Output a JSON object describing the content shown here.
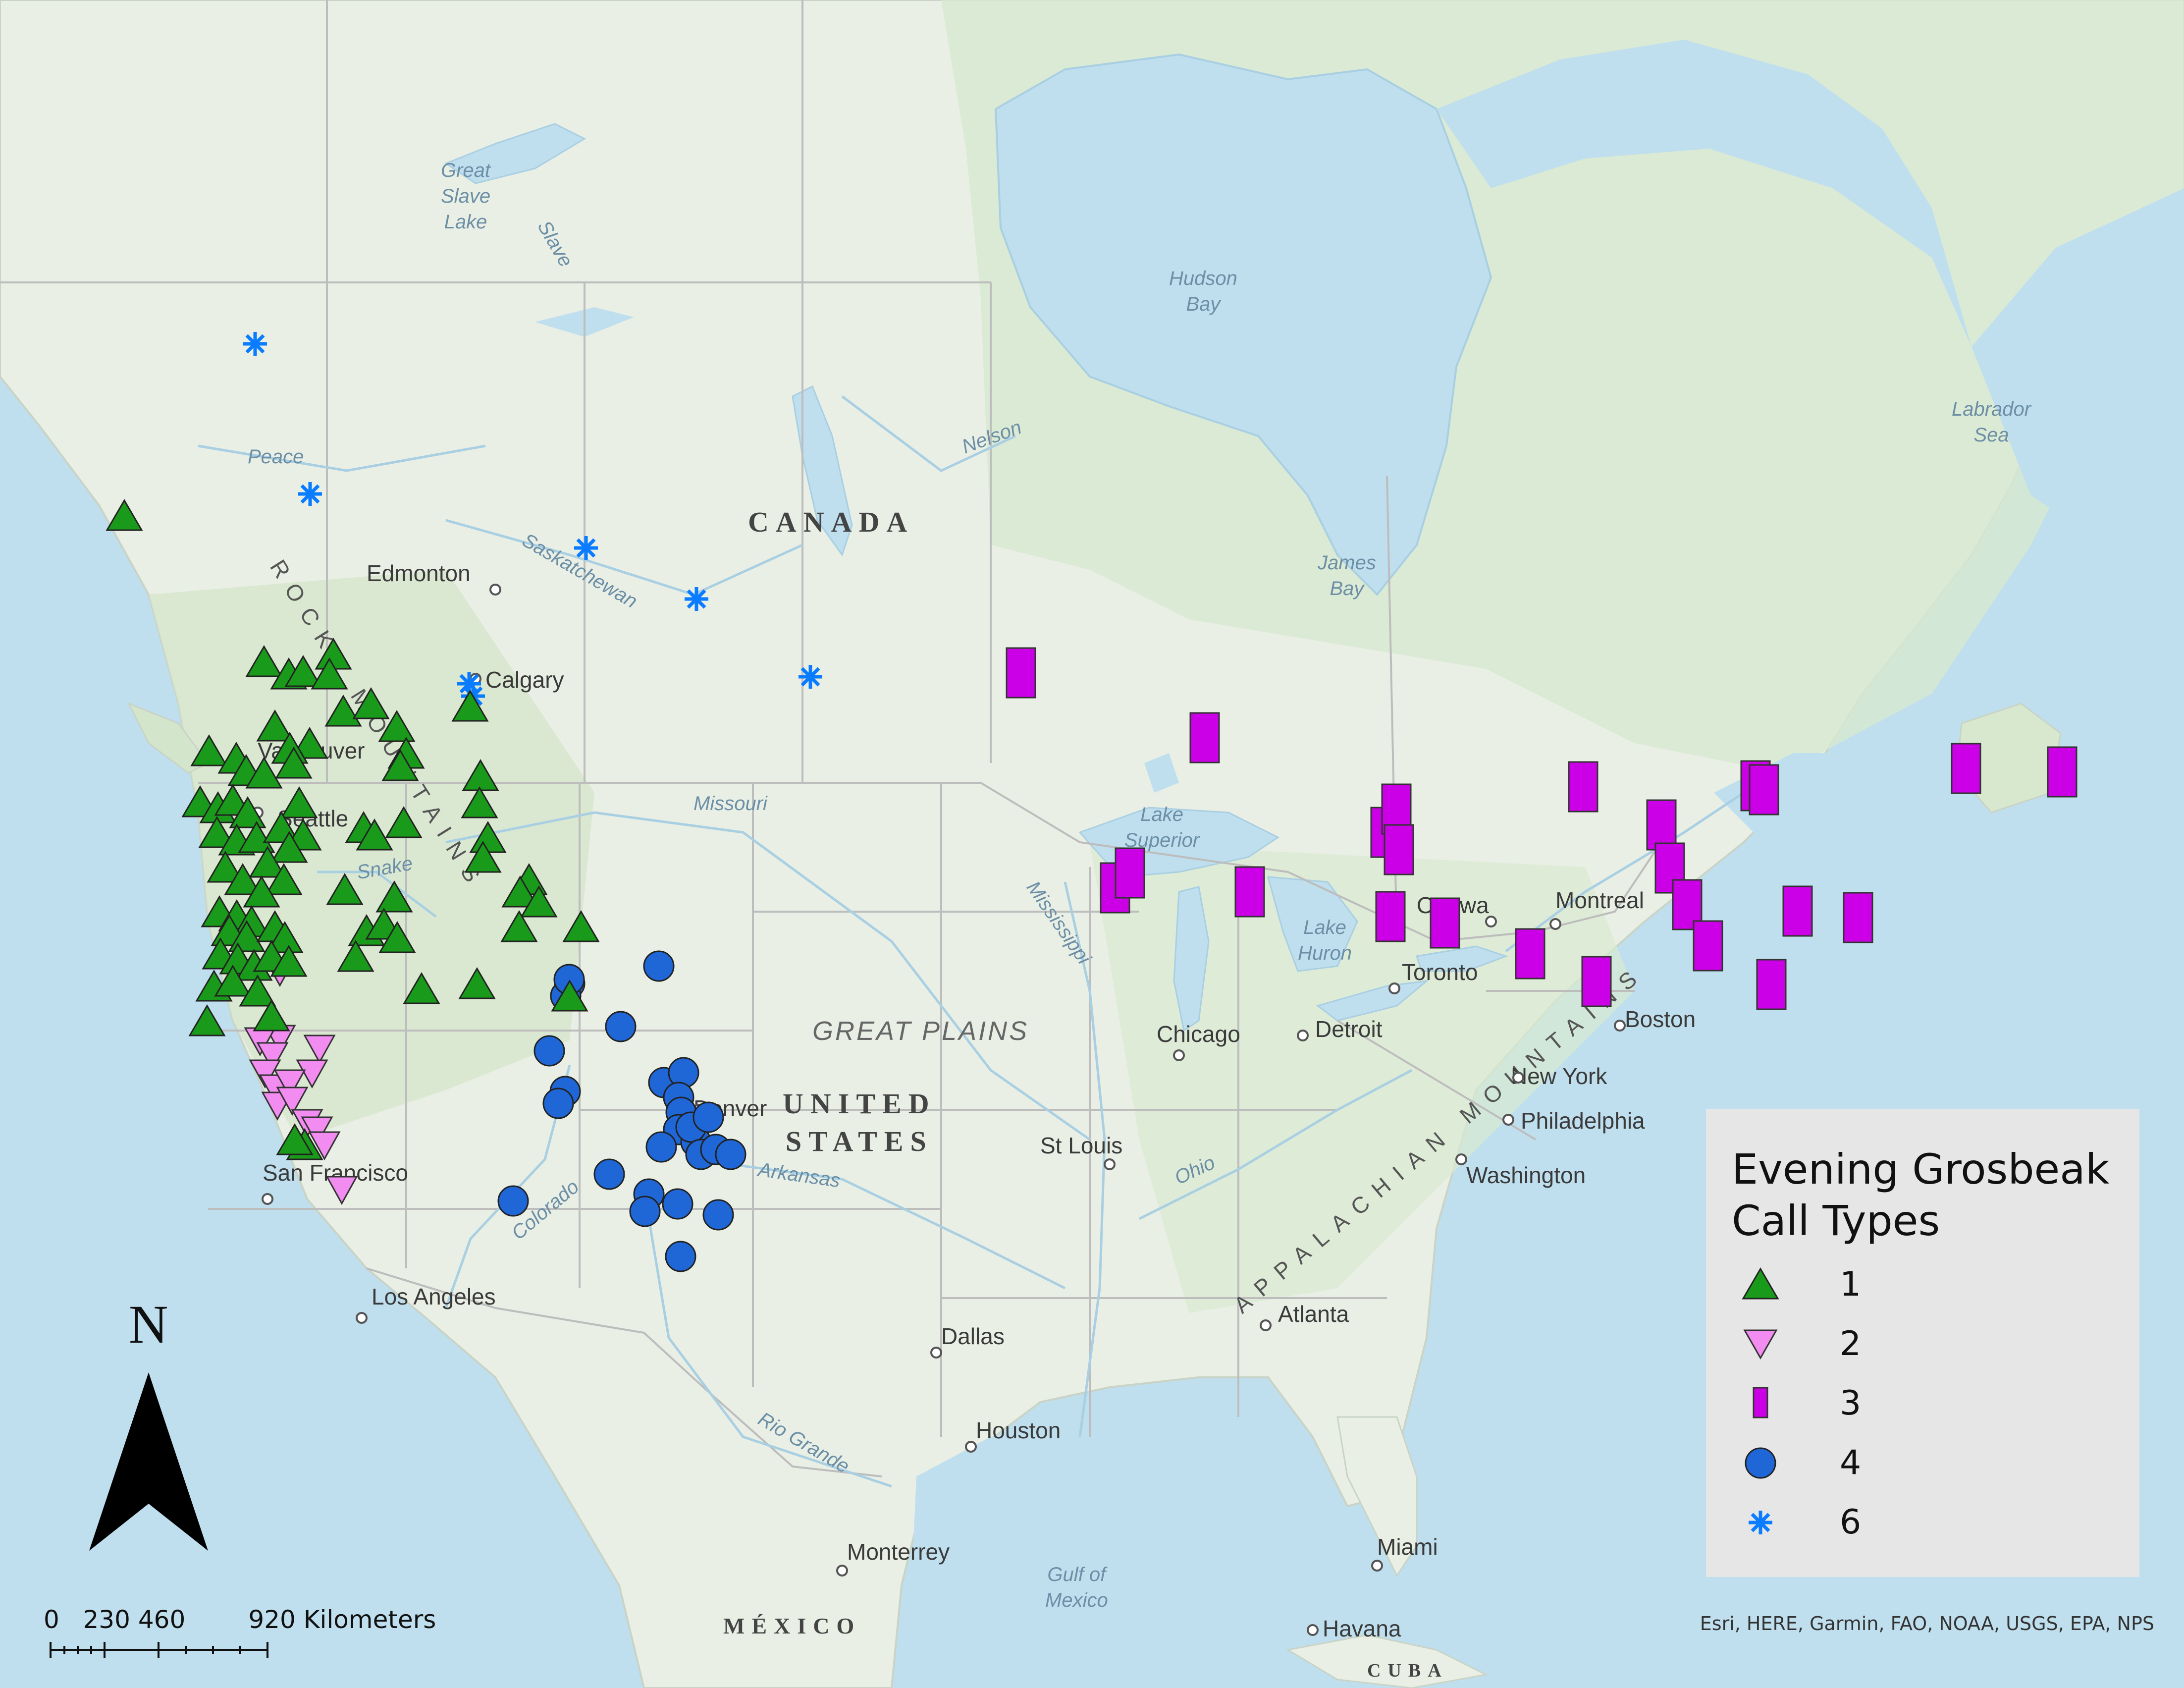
{
  "colors": {
    "ocean": "#bfdfee",
    "land": "#e9efe5",
    "forest": "#d7e8cf",
    "boundary": "#bdbdbd",
    "call_type_1": "#1a9a1a",
    "call_type_2": "#f28cf0",
    "call_type_3": "#cc00e6",
    "call_type_4": "#1f66d6",
    "call_type_6": "#0a7cff"
  },
  "map": {
    "countries": [
      {
        "id": "canada",
        "label": "CANADA"
      },
      {
        "id": "usa",
        "label": "UNITED\nSTATES"
      },
      {
        "id": "mexico",
        "label": "MÉXICO"
      }
    ],
    "regions": [
      {
        "id": "great-plains",
        "label": "GREAT PLAINS"
      },
      {
        "id": "rocky-mountains",
        "label": "ROCKY MOUNTAINS"
      },
      {
        "id": "appalachian",
        "label": "APPALACHIAN MOUNTAINS"
      }
    ],
    "water_labels": [
      {
        "id": "great-slave-lake",
        "label": "Great\nSlave\nLake"
      },
      {
        "id": "hudson-bay",
        "label": "Hudson\nBay"
      },
      {
        "id": "james-bay",
        "label": "James\nBay"
      },
      {
        "id": "labrador-sea",
        "label": "Labrador\nSea"
      },
      {
        "id": "lake-superior",
        "label": "Lake\nSuperior"
      },
      {
        "id": "lake-huron",
        "label": "Lake\nHuron"
      },
      {
        "id": "gulf-of-mexico",
        "label": "Gulf of\nMexico"
      },
      {
        "id": "peace-river",
        "label": "Peace"
      },
      {
        "id": "slave-river",
        "label": "Slave"
      },
      {
        "id": "nelson-river",
        "label": "Nelson"
      },
      {
        "id": "saskatchewan-river",
        "label": "Saskatchewan"
      },
      {
        "id": "missouri-river",
        "label": "Missouri"
      },
      {
        "id": "mississippi-river",
        "label": "Mississippi"
      },
      {
        "id": "snake-river",
        "label": "Snake"
      },
      {
        "id": "colorado-river",
        "label": "Colorado"
      },
      {
        "id": "arkansas-river",
        "label": "Arkansas"
      },
      {
        "id": "ohio-river",
        "label": "Ohio"
      },
      {
        "id": "rio-grande",
        "label": "Rio Grande"
      }
    ],
    "cities": [
      {
        "id": "edmonton",
        "label": "Edmonton"
      },
      {
        "id": "calgary",
        "label": "Calgary"
      },
      {
        "id": "vancouver",
        "label": "Vancouver"
      },
      {
        "id": "seattle",
        "label": "Seattle"
      },
      {
        "id": "san-francisco",
        "label": "San Francisco"
      },
      {
        "id": "los-angeles",
        "label": "Los Angeles"
      },
      {
        "id": "denver",
        "label": "Denver"
      },
      {
        "id": "dallas",
        "label": "Dallas"
      },
      {
        "id": "houston",
        "label": "Houston"
      },
      {
        "id": "monterrey",
        "label": "Monterrey"
      },
      {
        "id": "chicago",
        "label": "Chicago"
      },
      {
        "id": "detroit",
        "label": "Detroit"
      },
      {
        "id": "st-louis",
        "label": "St Louis"
      },
      {
        "id": "toronto",
        "label": "Toronto"
      },
      {
        "id": "ottawa",
        "label": "Ottawa"
      },
      {
        "id": "montreal",
        "label": "Montreal"
      },
      {
        "id": "boston",
        "label": "Boston"
      },
      {
        "id": "new-york",
        "label": "New York"
      },
      {
        "id": "philadelphia",
        "label": "Philadelphia"
      },
      {
        "id": "washington",
        "label": "Washington"
      },
      {
        "id": "atlanta",
        "label": "Atlanta"
      },
      {
        "id": "miami",
        "label": "Miami"
      },
      {
        "id": "havana",
        "label": "Havana"
      },
      {
        "id": "cuba",
        "label": "CUBA"
      }
    ]
  },
  "legend": {
    "title": "Evening Grosbeak\nCall Types",
    "items": [
      {
        "label": "1",
        "symbol": "triangle-up",
        "color": "#1a9a1a"
      },
      {
        "label": "2",
        "symbol": "triangle-down",
        "color": "#f28cf0"
      },
      {
        "label": "3",
        "symbol": "rectangle",
        "color": "#cc00e6"
      },
      {
        "label": "4",
        "symbol": "circle",
        "color": "#1f66d6"
      },
      {
        "label": "6",
        "symbol": "asterisk",
        "color": "#0a7cff"
      }
    ]
  },
  "north_arrow": {
    "label": "N"
  },
  "scale_bar": {
    "text": "0   230 460        920 Kilometers"
  },
  "attribution": "Esri, HERE, Garmin, FAO, NOAA, USGS, EPA, NPS"
}
